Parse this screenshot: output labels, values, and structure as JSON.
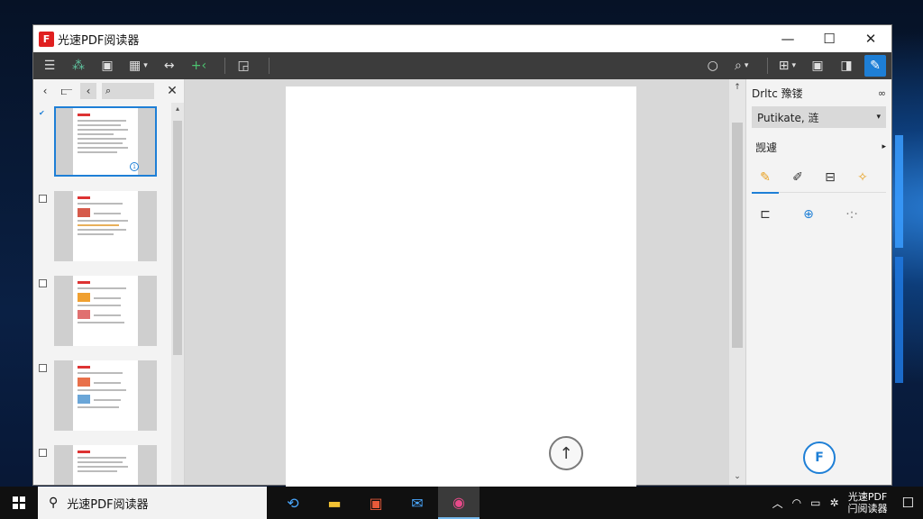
{
  "window": {
    "title": "光速PDF阅读器",
    "logo_glyph": "F",
    "controls": {
      "minimize": "—",
      "maximize": "☐",
      "close": "✕"
    }
  },
  "toolbar": {
    "menu": "☰",
    "share": "⁂",
    "save": "▣",
    "page_layout": "▦",
    "page_layout_caret": "▾",
    "nav": "↔",
    "nav_green": "+‹",
    "export": "◲",
    "search": "○",
    "zoom": "⌕",
    "zoom_caret": "▾",
    "view": "⊞",
    "view_caret": "▾",
    "thumbnail": "▣",
    "sidebar": "◨",
    "annotate": "✎"
  },
  "left_panel": {
    "back": "‹",
    "collapse": "⫍",
    "prev": "‹",
    "search_icon": "⌕",
    "close": "✕",
    "scroll_up": "▴",
    "scroll_down": "▾",
    "selected_badge": "1",
    "checked_mark": "✔"
  },
  "doc": {
    "scroll_top_icon": "↑",
    "scroll_up": "↑",
    "scroll_down": "⌄"
  },
  "right_panel": {
    "header": "Drltc 豫镂",
    "header_extra": "∞",
    "dropdown_value": "Putikate, 涟",
    "dropdown_caret": "▾",
    "row_label": "觊遽",
    "row_caret": "▸",
    "tool_1": "✎",
    "tool_2": "✐",
    "tool_3": "⊟",
    "tool_4": "✧",
    "tool_5": "⊏",
    "tool_6": "⊕",
    "tool_7": "·:·",
    "fab": "F"
  },
  "taskbar": {
    "search_icon": "⚲",
    "search_text": "光速PDF阅读器",
    "app_1": "⟲",
    "app_2": "▬",
    "app_3": "▣",
    "app_4": "✉",
    "app_5": "◉",
    "tray_up": "︿",
    "tray_net": "◠",
    "tray_speaker": "▭",
    "tray_settings": "✲",
    "clock_line1": "光速PDF",
    "clock_line2": "闩阅读器",
    "notifications": "☐"
  }
}
